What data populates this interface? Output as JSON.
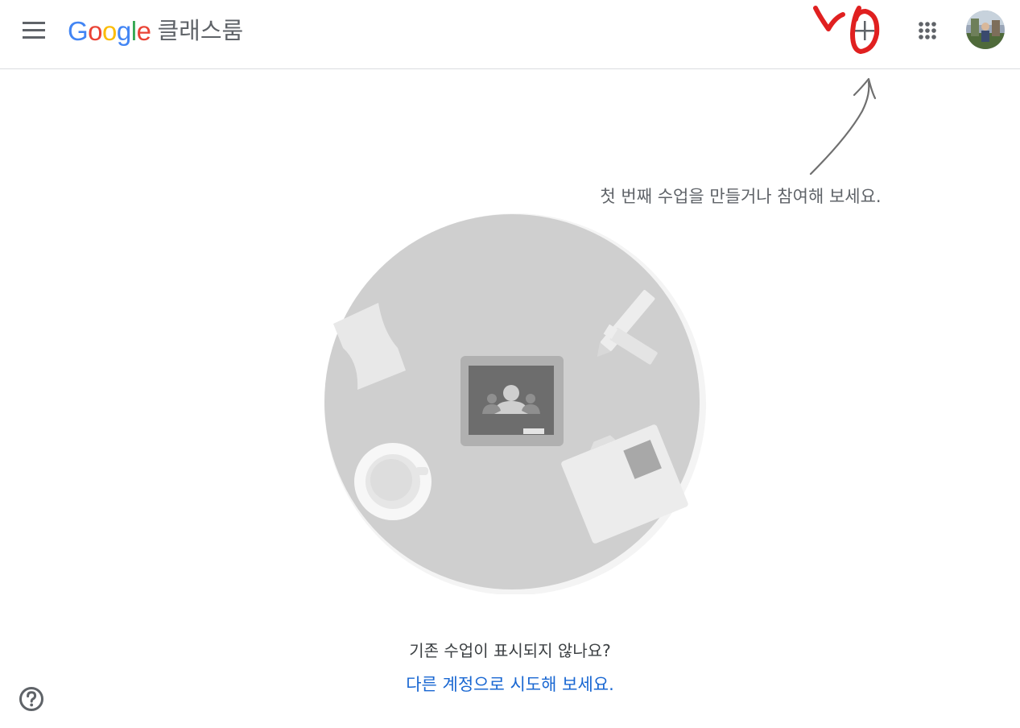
{
  "header": {
    "logo_letters": [
      {
        "ch": "G",
        "color": "#4285F4"
      },
      {
        "ch": "o",
        "color": "#EA4335"
      },
      {
        "ch": "o",
        "color": "#FBBC05"
      },
      {
        "ch": "g",
        "color": "#4285F4"
      },
      {
        "ch": "l",
        "color": "#34A853"
      },
      {
        "ch": "e",
        "color": "#EA4335"
      }
    ],
    "product_name": "클래스룸",
    "icons": {
      "menu": "hamburger-menu-icon",
      "create": "plus-icon",
      "apps": "apps-grid-icon",
      "account": "account-avatar"
    }
  },
  "annotation": {
    "mark_color": "#e02020"
  },
  "empty_state": {
    "hint": "첫 번째 수업을 만들거나 참여해 보세요.",
    "question": "기존 수업이 표시되지 않나요?",
    "link": "다른 계정으로 시도해 보세요."
  },
  "colors": {
    "link": "#1967d2",
    "icon": "#5f6368"
  }
}
